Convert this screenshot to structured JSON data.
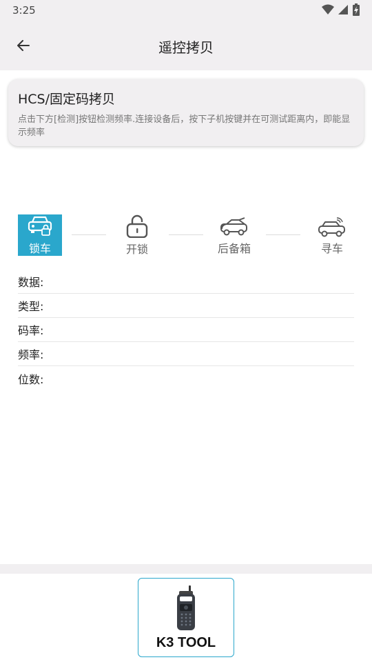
{
  "status_bar": {
    "time": "3:25"
  },
  "app_bar": {
    "title": "遥控拷贝"
  },
  "info_card": {
    "title": "HCS/固定码拷贝",
    "description": "点击下方[检测]按钮检测频率.连接设备后，按下子机按键并在可测试距离内，即能显示频率"
  },
  "keys": [
    {
      "label": "锁车",
      "icon": "car-lock-icon",
      "selected": true
    },
    {
      "label": "开锁",
      "icon": "unlock-icon",
      "selected": false
    },
    {
      "label": "后备箱",
      "icon": "car-trunk-icon",
      "selected": false
    },
    {
      "label": "寻车",
      "icon": "find-car-icon",
      "selected": false
    }
  ],
  "fields": [
    {
      "label": "数据:"
    },
    {
      "label": "类型:"
    },
    {
      "label": "码率:"
    },
    {
      "label": "频率:"
    },
    {
      "label": "位数:"
    }
  ],
  "device": {
    "name": "K3 TOOL",
    "icon": "remote-device-icon"
  },
  "colors": {
    "accent": "#2aa7cc",
    "bar_background": "#f1eff1"
  }
}
